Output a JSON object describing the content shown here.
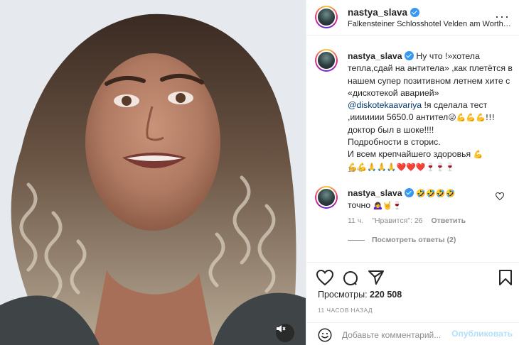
{
  "post": {
    "username": "nastya_slava",
    "location": "Falkensteiner Schlosshotel Velden am Worthe...",
    "more_icon": "ellipsis-icon"
  },
  "caption": {
    "username": "nastya_slava",
    "line1": "Ну что !»хотела тепла,сдай на антитела» ,как плетётся в нашем супер позитивном летнем хите с «дискотекой аварией»",
    "mention": "@diskotekaavariya",
    "line2": " !я сделала тест ,иииииии 5650.0 антител",
    "emoji1": "😜💪💪💪!!!",
    "line3": "доктор был в шоке!!!!",
    "line4": "Подробности в сторис.",
    "line5": "И всем крепчайшего здоровья",
    "emoji2": "💪",
    "emoji3": "💪💪🙏🙏🙏❤️❤️❤️🍷🍷🍷",
    "time": "11 ч."
  },
  "comment": {
    "username": "nastya_slava",
    "emoji": "🤣🤣🤣🤣",
    "text": "точно",
    "text_emoji": "🙇‍♀️🤘🍷",
    "time": "11 ч.",
    "likes": "\"Нравится\": 26",
    "reply": "Ответить",
    "view_replies": "Посмотреть ответы (2)"
  },
  "stats": {
    "views_label": "Просмотры:",
    "views_value": "220 508",
    "posted": "11 ЧАСОВ НАЗАД"
  },
  "add_comment": {
    "placeholder": "Добавьте комментарий...",
    "publish": "Опубликовать"
  },
  "colors": {
    "verified": "#3897f0",
    "mention": "#00376b",
    "publish_disabled": "#b2dffc"
  }
}
